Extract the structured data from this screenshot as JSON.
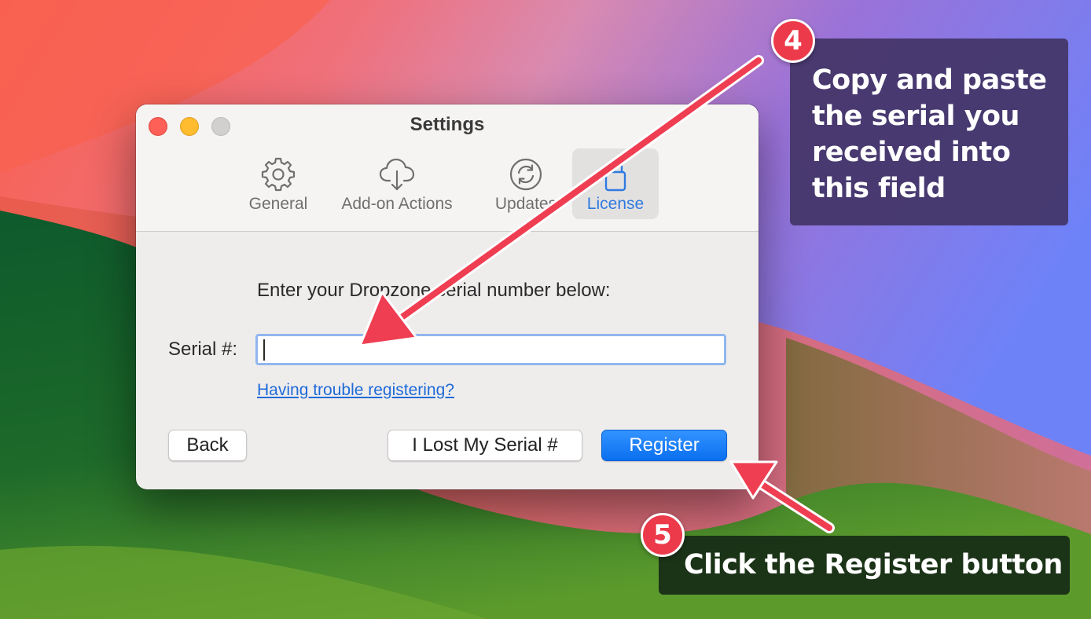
{
  "window": {
    "title": "Settings",
    "tabs": [
      {
        "label": "General",
        "icon": "gear-icon"
      },
      {
        "label": "Add-on Actions",
        "icon": "cloud-download-icon"
      },
      {
        "label": "Updates",
        "icon": "refresh-icon"
      },
      {
        "label": "License",
        "icon": "lock-icon",
        "active": true
      }
    ]
  },
  "license": {
    "prompt": "Enter your Dropzone serial number below:",
    "serial_label": "Serial #:",
    "serial_value": "",
    "help_link": "Having trouble registering?"
  },
  "buttons": {
    "back": "Back",
    "lost_serial": "I Lost My Serial #",
    "register": "Register"
  },
  "annotations": {
    "step4": {
      "number": "4",
      "text": "Copy and paste the serial you received into this field"
    },
    "step5": {
      "number": "5",
      "text": "Click the Register button"
    }
  },
  "colors": {
    "accent": "#0a6ff0",
    "annotation_badge": "#ec3a4b",
    "arrow": "#ef3e52",
    "callout_4_bg": "#423466",
    "callout_5_bg": "#162a16"
  }
}
